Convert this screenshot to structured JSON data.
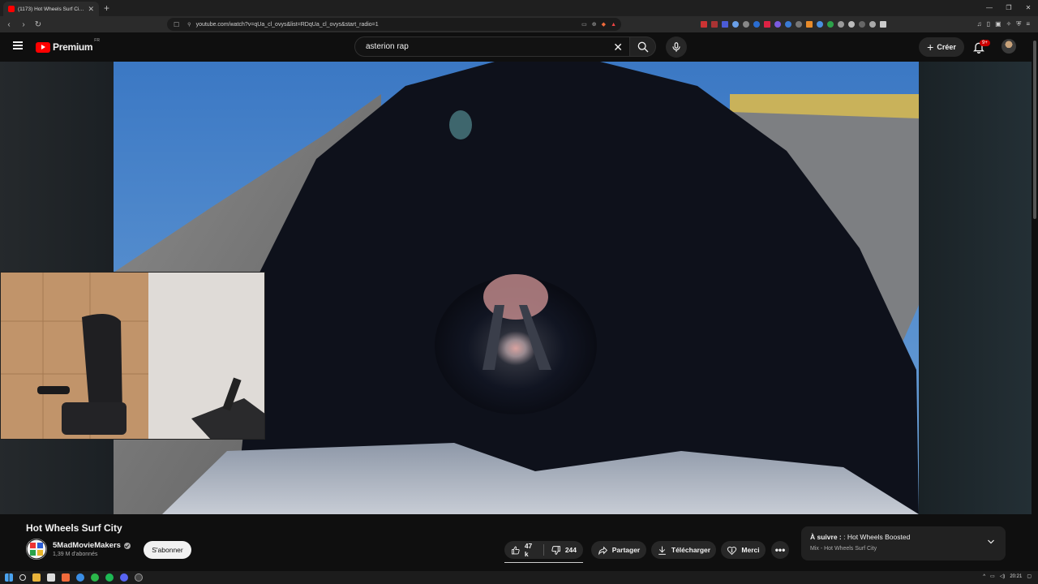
{
  "browser": {
    "tab_title": "(1173) Hot Wheels Surf City - Yo",
    "url": "youtube.com/watch?v=qUa_cl_ovys&list=RDqUa_cl_ovys&start_radio=1"
  },
  "header": {
    "brand": "Premium",
    "region": "FR",
    "search_value": "asterion rap",
    "create_label": "Créer",
    "notifications_badge": "9+"
  },
  "video": {
    "title": "Hot Wheels Surf City"
  },
  "channel": {
    "name": "5MadMovieMakers",
    "subscribers": "1,39 M d'abonnés",
    "avatar_text": "5M",
    "subscribe_label": "S'abonner"
  },
  "actions": {
    "likes": "47 k",
    "dislikes": "244",
    "share_label": "Partager",
    "download_label": "Télécharger",
    "thanks_label": "Merci"
  },
  "up_next": {
    "prefix": "À suivre :",
    "title": ": Hot Wheels Boosted",
    "subtitle": "Mix - Hot Wheels Surf City"
  },
  "taskbar": {
    "clock": "20:21"
  },
  "colors": {
    "brand_red": "#ff0000",
    "background": "#0f0f0f",
    "pill_bg": "#272727"
  }
}
